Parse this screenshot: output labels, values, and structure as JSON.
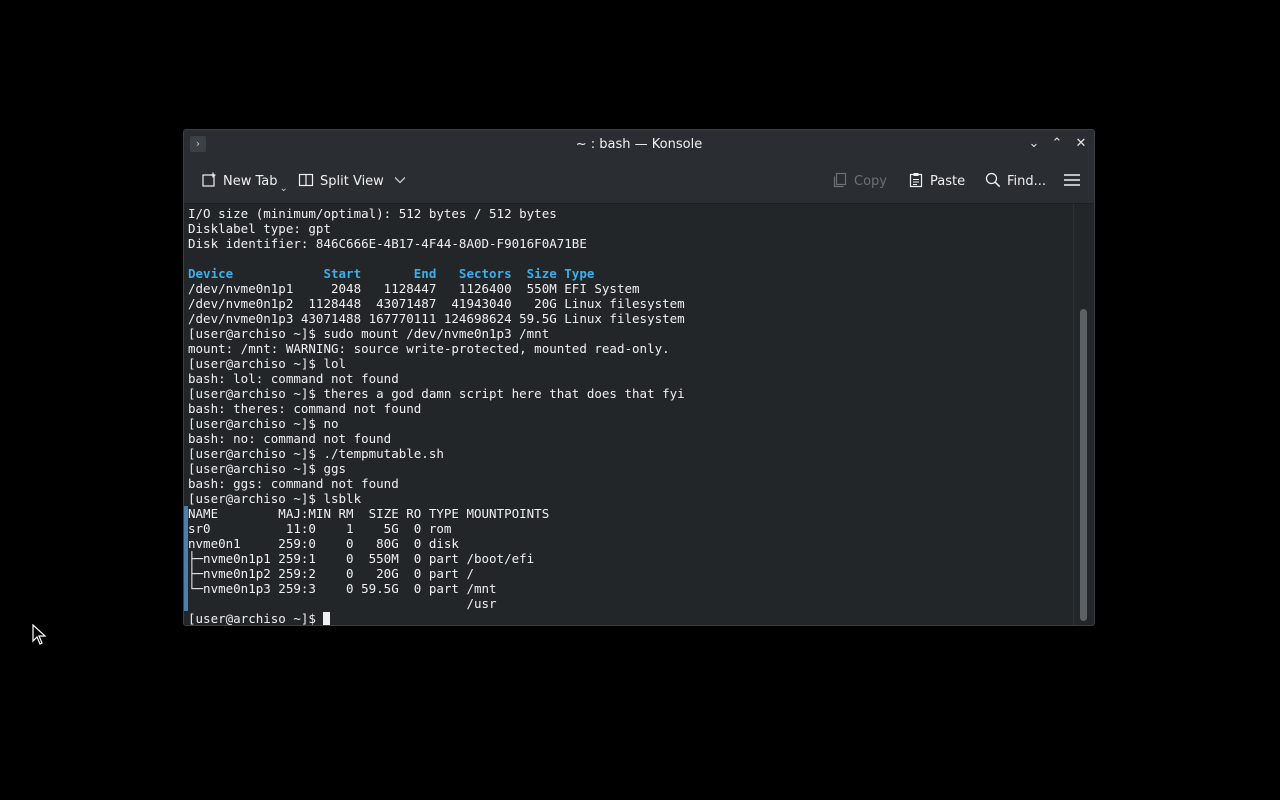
{
  "window": {
    "title": "~ : bash — Konsole",
    "menu_glyph": "›",
    "minimize_glyph": "⌄",
    "maximize_glyph": "⌃",
    "close_glyph": "✕"
  },
  "toolbar": {
    "new_tab": "New Tab",
    "split_view": "Split View",
    "copy": "Copy",
    "paste": "Paste",
    "find": "Find...",
    "menu_icon": "hamburger-menu-icon"
  },
  "terminal": {
    "lines": [
      "I/O size (minimum/optimal): 512 bytes / 512 bytes",
      "Disklabel type: gpt",
      "Disk identifier: 846C666E-4B17-4F44-8A0D-F9016F0A71BE",
      "",
      "Device            Start       End   Sectors  Size Type",
      "/dev/nvme0n1p1     2048   1128447   1126400  550M EFI System",
      "/dev/nvme0n1p2  1128448  43071487  41943040   20G Linux filesystem",
      "/dev/nvme0n1p3 43071488 167770111 124698624 59.5G Linux filesystem",
      "[user@archiso ~]$ sudo mount /dev/nvme0n1p3 /mnt",
      "mount: /mnt: WARNING: source write-protected, mounted read-only.",
      "[user@archiso ~]$ lol",
      "bash: lol: command not found",
      "[user@archiso ~]$ theres a god damn script here that does that fyi",
      "bash: theres: command not found",
      "[user@archiso ~]$ no",
      "bash: no: command not found",
      "[user@archiso ~]$ ./tempmutable.sh",
      "[user@archiso ~]$ ggs",
      "bash: ggs: command not found",
      "[user@archiso ~]$ lsblk",
      "NAME        MAJ:MIN RM  SIZE RO TYPE MOUNTPOINTS",
      "sr0          11:0    1    5G  0 rom",
      "nvme0n1     259:0    0   80G  0 disk",
      "├─nvme0n1p1 259:1    0  550M  0 part /boot/efi",
      "├─nvme0n1p2 259:2    0   20G  0 part /",
      "└─nvme0n1p3 259:3    0 59.5G  0 part /mnt",
      "                                     /usr"
    ],
    "prompt": "[user@archiso ~]$ "
  },
  "colors": {
    "header_accent": "#3daee9",
    "background": "#232629",
    "text": "#eff0f1"
  }
}
